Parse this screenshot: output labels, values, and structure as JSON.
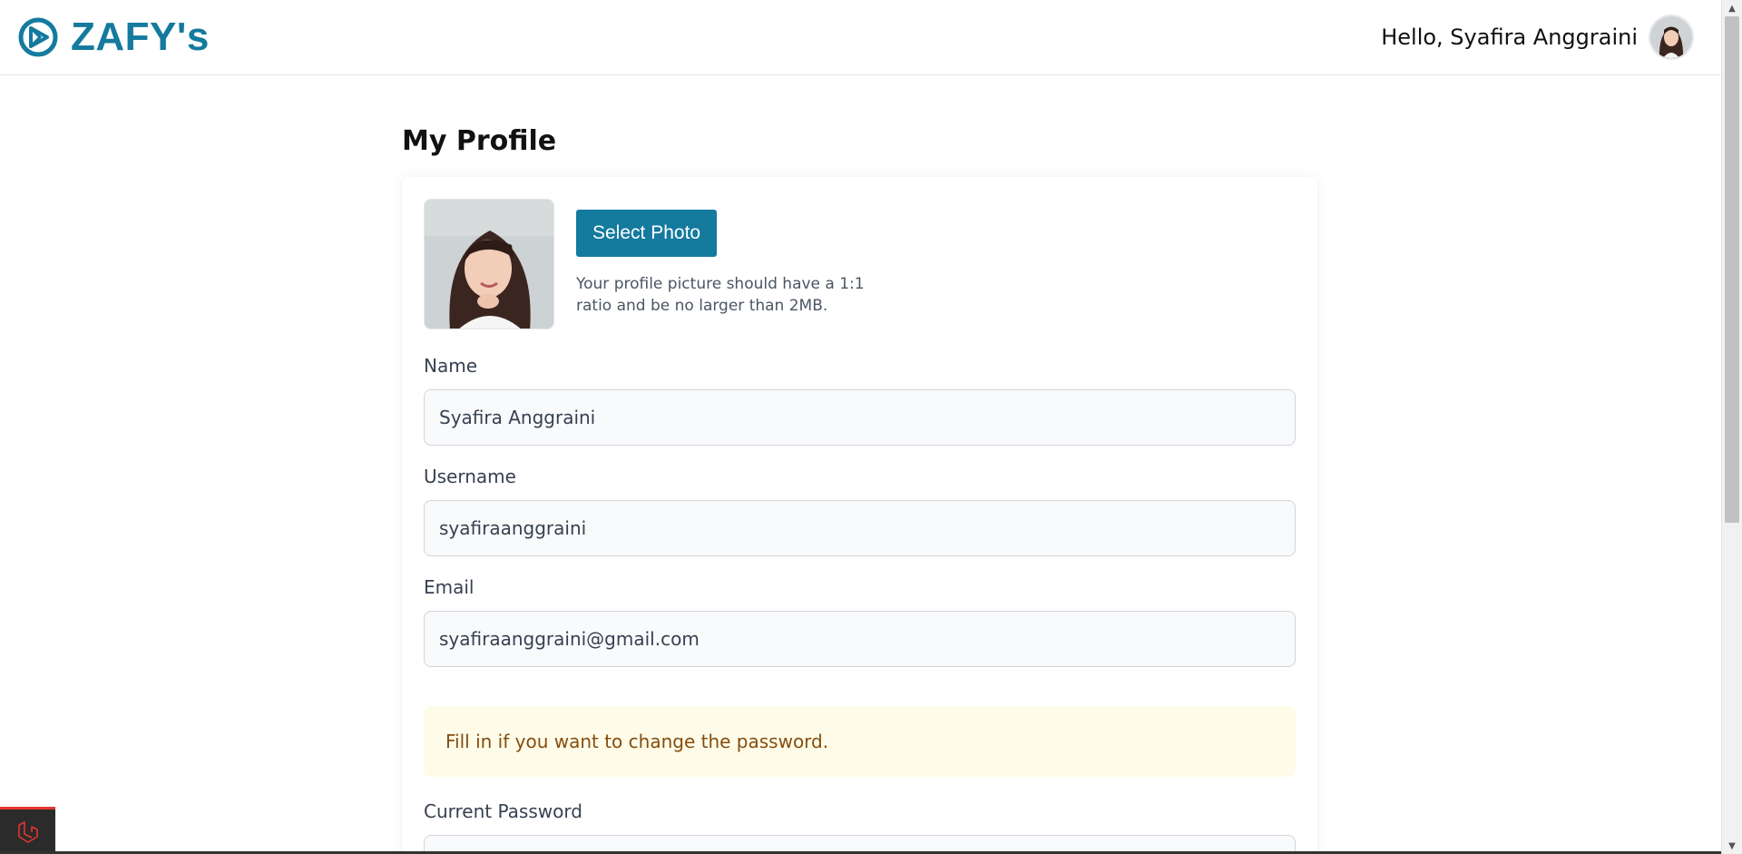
{
  "header": {
    "brand_name": "ZAFY's",
    "greeting": "Hello, Syafira Anggraini"
  },
  "main": {
    "title": "My Profile",
    "photo": {
      "select_label": "Select Photo",
      "hint": "Your profile picture should have a 1:1 ratio and be no larger than 2MB."
    },
    "fields": {
      "name": {
        "label": "Name",
        "value": "Syafira Anggraini"
      },
      "username": {
        "label": "Username",
        "value": "syafiraanggraini"
      },
      "email": {
        "label": "Email",
        "value": "syafiraanggraini@gmail.com"
      }
    },
    "password_notice": "Fill in if you want to change the password.",
    "current_password": {
      "label": "Current Password",
      "value": ""
    }
  },
  "colors": {
    "brand": "#147a9e",
    "notice_bg": "#fefce8",
    "notice_text": "#854d0e"
  },
  "icons": [
    "brand-logo-icon",
    "user-avatar",
    "profile-photo",
    "laravel-debugbar-icon"
  ]
}
